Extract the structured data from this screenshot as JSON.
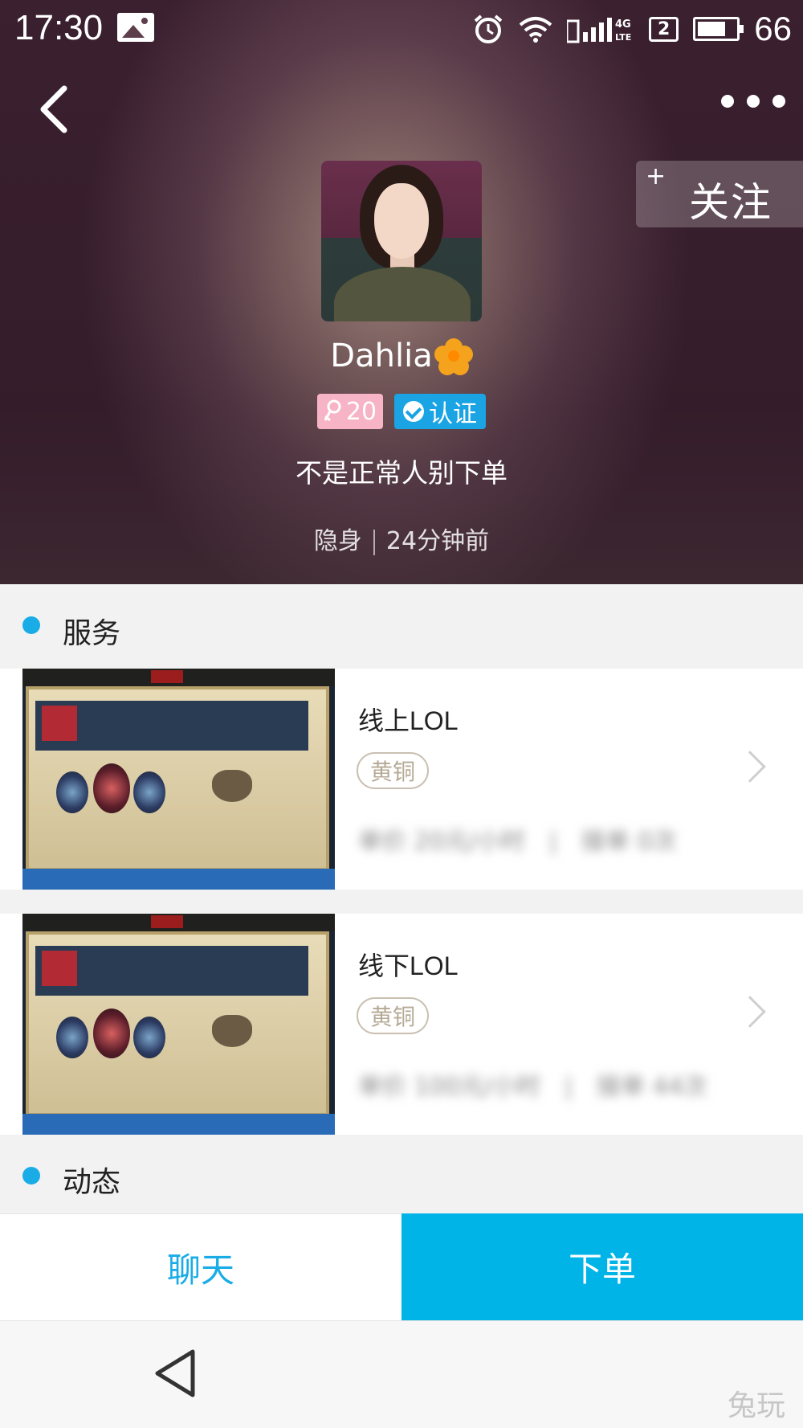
{
  "status_bar": {
    "time": "17:30",
    "sim_slot": "2",
    "battery": "66",
    "network": "4G LTE"
  },
  "header": {
    "follow_plus": "+",
    "follow_label": "关注",
    "name": "Dahlia",
    "age": "20",
    "verified_label": "认证",
    "bio": "不是正常人别下单",
    "presence": "隐身",
    "last_active": "24分钟前"
  },
  "services_section": {
    "title": "服务"
  },
  "services": [
    {
      "title": "线上LOL",
      "rank": "黄铜",
      "price": "单价 20元/小时",
      "orders": "接单 0次"
    },
    {
      "title": "线下LOL",
      "rank": "黄铜",
      "price": "单价 100元/小时",
      "orders": "接单 44次"
    }
  ],
  "moments_section": {
    "title": "动态"
  },
  "actions": {
    "chat": "聊天",
    "order": "下单"
  },
  "watermark": "兔玩",
  "colors": {
    "accent": "#00b4e8",
    "age_badge": "#f8b4c7",
    "verify_badge": "#1aa4e3",
    "flower": "#f5a21c"
  }
}
